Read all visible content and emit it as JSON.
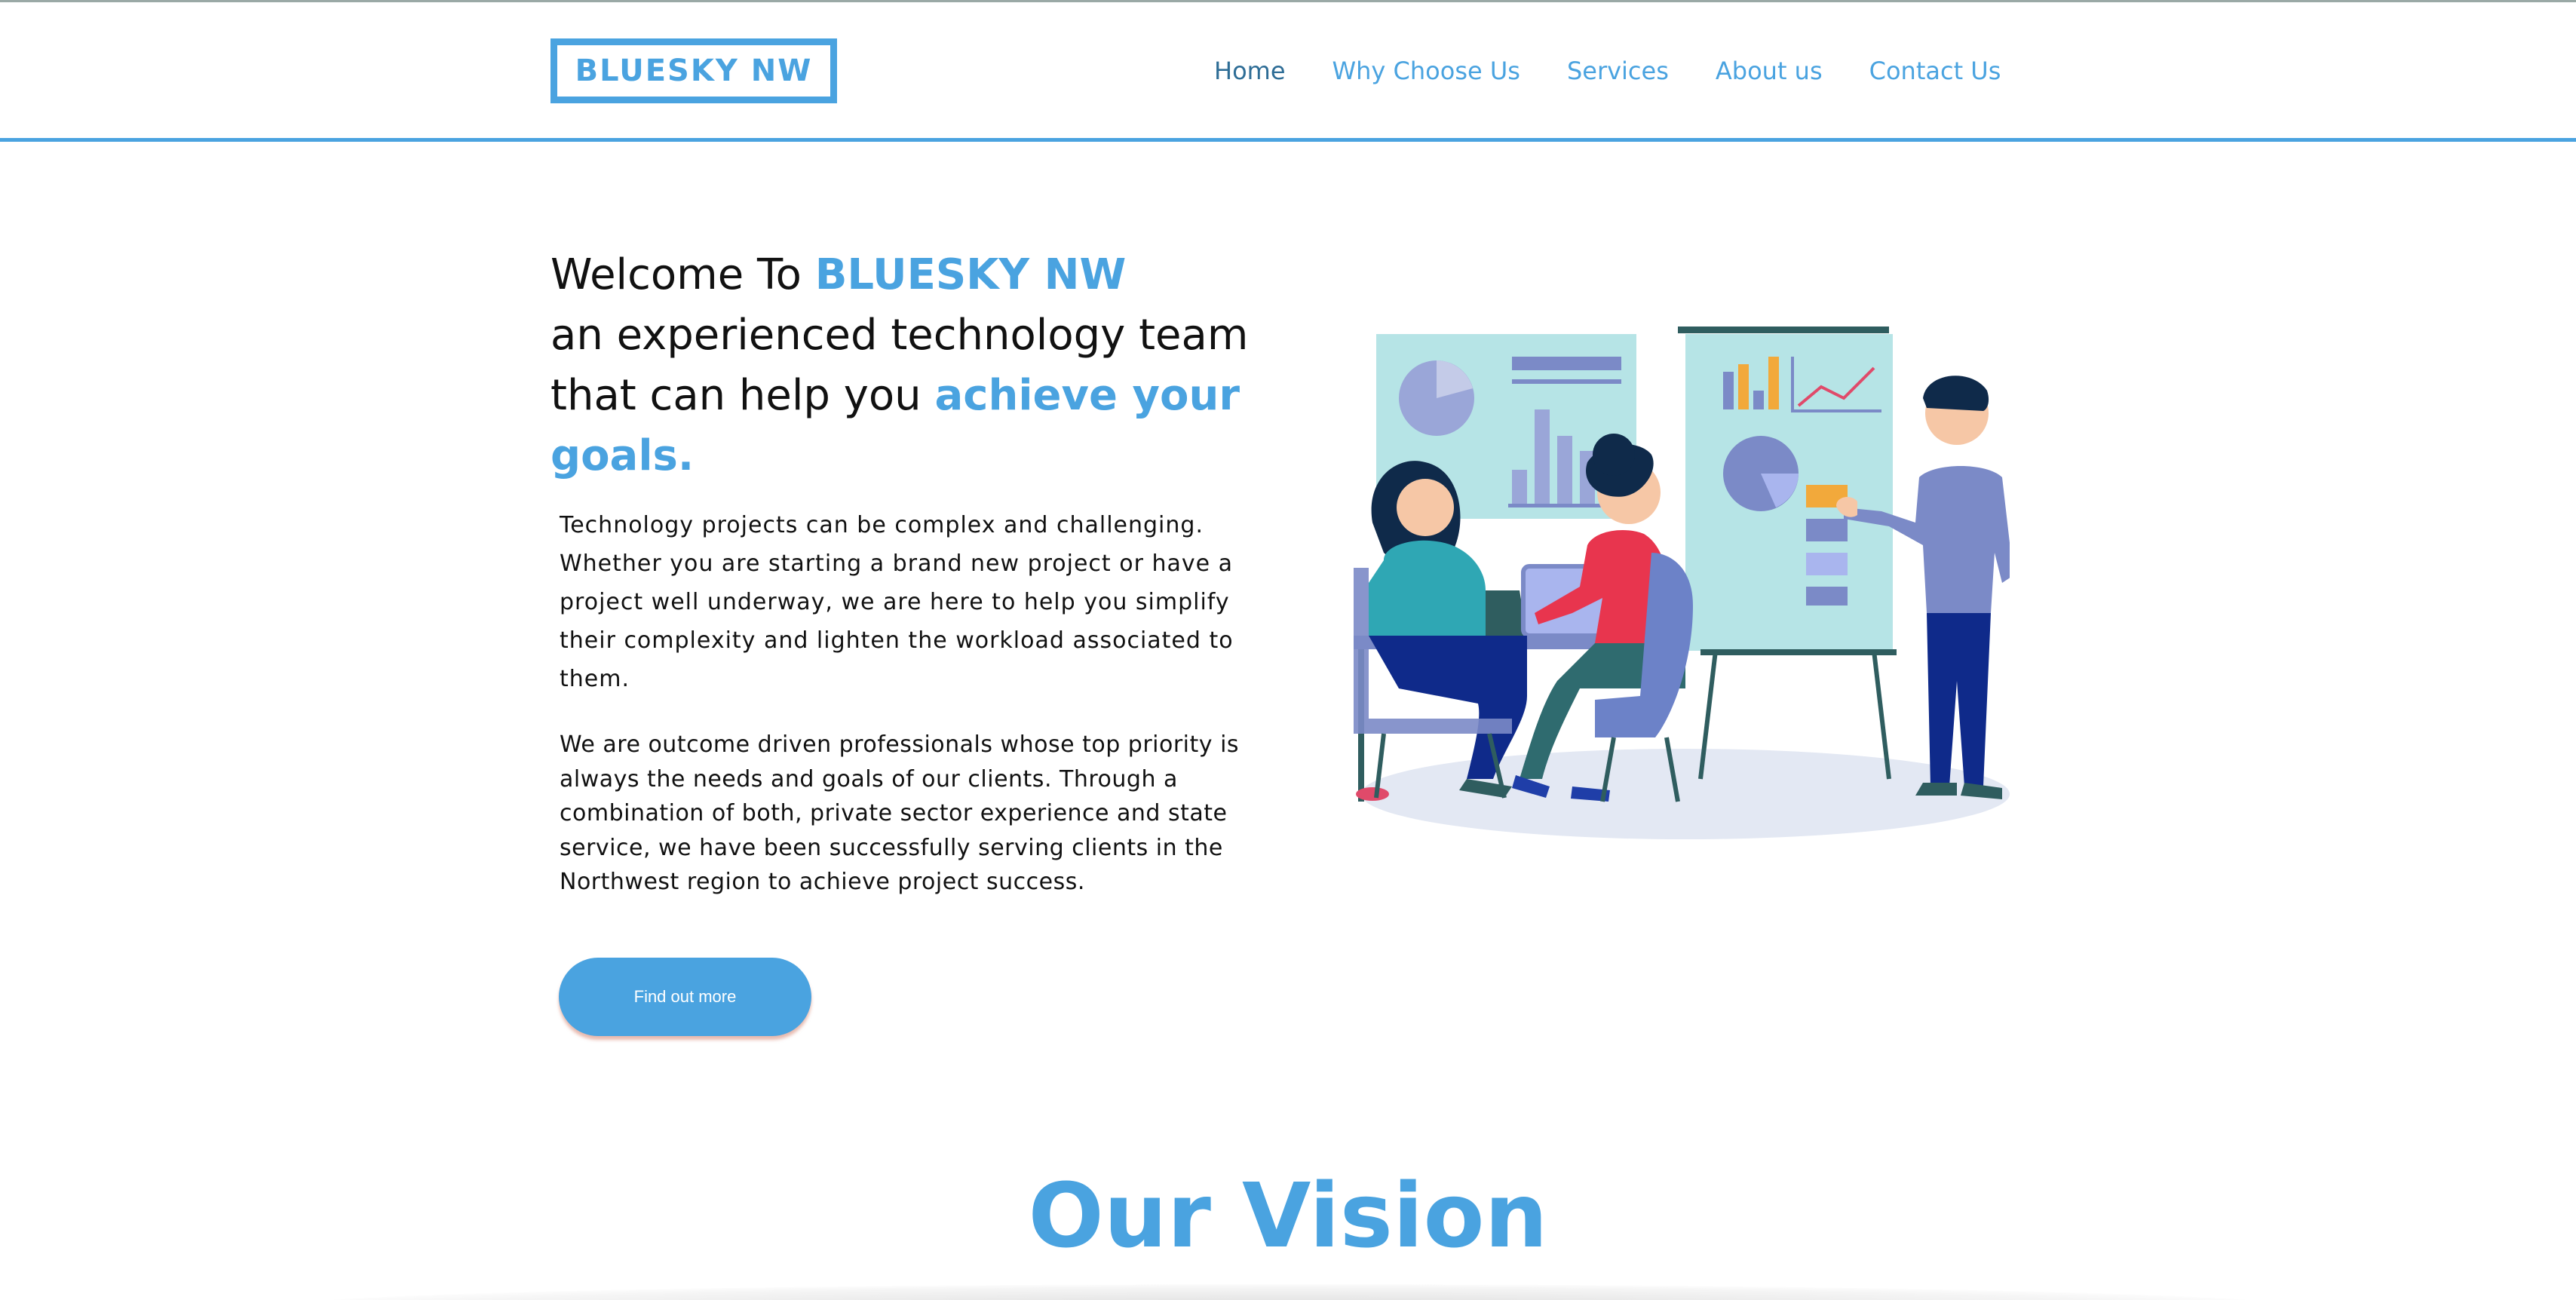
{
  "header": {
    "logo_text": "BLUESKY NW",
    "nav": [
      {
        "label": "Home",
        "active": true
      },
      {
        "label": "Why Choose Us",
        "active": false
      },
      {
        "label": "Services",
        "active": false
      },
      {
        "label": "About us",
        "active": false
      },
      {
        "label": "Contact Us",
        "active": false
      }
    ]
  },
  "hero": {
    "line1_prefix": "Welcome To ",
    "line1_brand": "BLUESKY NW",
    "line2": "an experienced technology team",
    "line3_prefix": "that can help you ",
    "line3_accent": "achieve your goals.",
    "paragraph1": "Technology projects can be complex and challenging. Whether you are starting a brand new project or have a project well underway, we are here to help you simplify their complexity and lighten the workload associated to them.",
    "paragraph2": "We are outcome driven professionals whose top priority is always the needs and goals of our clients. Through a combination of both, private sector experience and state service, we have been successfully serving clients in the Northwest region to achieve project success.",
    "cta_label": "Find out more"
  },
  "vision": {
    "title": "Our Vision"
  },
  "colors": {
    "accent": "#4aa3e0",
    "nav_active": "#2e6d96",
    "text": "#111111"
  }
}
